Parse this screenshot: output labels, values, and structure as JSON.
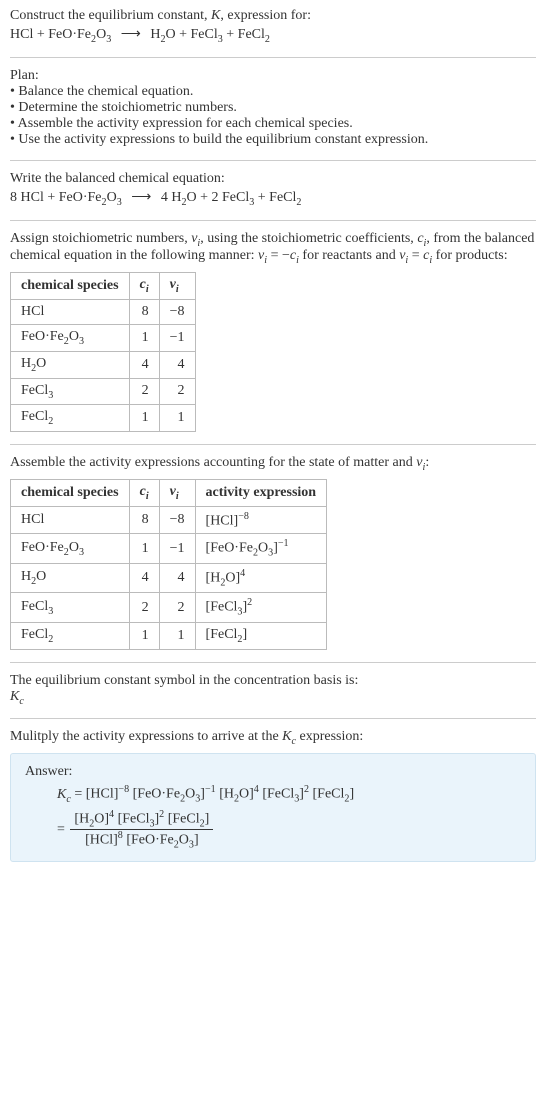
{
  "header": {
    "title_html": "Construct the equilibrium constant, <span class='italic'>K</span>, expression for:",
    "equation_html": "HCl + FeO·Fe<span class='sub'>2</span>O<span class='sub'>3</span> <span class='arrow'>⟶</span> H<span class='sub'>2</span>O + FeCl<span class='sub'>3</span> + FeCl<span class='sub'>2</span>"
  },
  "plan": {
    "heading": "Plan:",
    "items": [
      "Balance the chemical equation.",
      "Determine the stoichiometric numbers.",
      "Assemble the activity expression for each chemical species.",
      "Use the activity expressions to build the equilibrium constant expression."
    ]
  },
  "balanced": {
    "heading": "Write the balanced chemical equation:",
    "equation_html": "8 HCl + FeO·Fe<span class='sub'>2</span>O<span class='sub'>3</span> <span class='arrow'>⟶</span> 4 H<span class='sub'>2</span>O + 2 FeCl<span class='sub'>3</span> + FeCl<span class='sub'>2</span>"
  },
  "stoich": {
    "intro_html": "Assign stoichiometric numbers, <span class='italic'>ν<span class='sub'>i</span></span>, using the stoichiometric coefficients, <span class='italic'>c<span class='sub'>i</span></span>, from the balanced chemical equation in the following manner: <span class='italic'>ν<span class='sub'>i</span></span> = −<span class='italic'>c<span class='sub'>i</span></span> for reactants and <span class='italic'>ν<span class='sub'>i</span></span> = <span class='italic'>c<span class='sub'>i</span></span> for products:",
    "headers": {
      "species": "chemical species",
      "ci_html": "<span class='italic'>c<span class='sub'>i</span></span>",
      "vi_html": "<span class='italic'>ν<span class='sub'>i</span></span>"
    },
    "rows": [
      {
        "species_html": "HCl",
        "ci": "8",
        "vi": "−8"
      },
      {
        "species_html": "FeO·Fe<span class='sub'>2</span>O<span class='sub'>3</span>",
        "ci": "1",
        "vi": "−1"
      },
      {
        "species_html": "H<span class='sub'>2</span>O",
        "ci": "4",
        "vi": "4"
      },
      {
        "species_html": "FeCl<span class='sub'>3</span>",
        "ci": "2",
        "vi": "2"
      },
      {
        "species_html": "FeCl<span class='sub'>2</span>",
        "ci": "1",
        "vi": "1"
      }
    ]
  },
  "activity": {
    "intro_html": "Assemble the activity expressions accounting for the state of matter and <span class='italic'>ν<span class='sub'>i</span></span>:",
    "headers": {
      "species": "chemical species",
      "ci_html": "<span class='italic'>c<span class='sub'>i</span></span>",
      "vi_html": "<span class='italic'>ν<span class='sub'>i</span></span>",
      "activity": "activity expression"
    },
    "rows": [
      {
        "species_html": "HCl",
        "ci": "8",
        "vi": "−8",
        "act_html": "[HCl]<span class='sup'>−8</span>"
      },
      {
        "species_html": "FeO·Fe<span class='sub'>2</span>O<span class='sub'>3</span>",
        "ci": "1",
        "vi": "−1",
        "act_html": "[FeO·Fe<span class='sub'>2</span>O<span class='sub'>3</span>]<span class='sup'>−1</span>"
      },
      {
        "species_html": "H<span class='sub'>2</span>O",
        "ci": "4",
        "vi": "4",
        "act_html": "[H<span class='sub'>2</span>O]<span class='sup'>4</span>"
      },
      {
        "species_html": "FeCl<span class='sub'>3</span>",
        "ci": "2",
        "vi": "2",
        "act_html": "[FeCl<span class='sub'>3</span>]<span class='sup'>2</span>"
      },
      {
        "species_html": "FeCl<span class='sub'>2</span>",
        "ci": "1",
        "vi": "1",
        "act_html": "[FeCl<span class='sub'>2</span>]"
      }
    ]
  },
  "basis": {
    "line1": "The equilibrium constant symbol in the concentration basis is:",
    "symbol_html": "<span class='italic'>K<span class='sub'>c</span></span>"
  },
  "multiply": {
    "intro_html": "Mulitply the activity expressions to arrive at the <span class='italic'>K<span class='sub'>c</span></span> expression:"
  },
  "answer": {
    "label": "Answer:",
    "line1_html": "<span class='italic'>K<span class='sub'>c</span></span> = [HCl]<span class='sup'>−8</span> [FeO·Fe<span class='sub'>2</span>O<span class='sub'>3</span>]<span class='sup'>−1</span> [H<span class='sub'>2</span>O]<span class='sup'>4</span> [FeCl<span class='sub'>3</span>]<span class='sup'>2</span> [FeCl<span class='sub'>2</span>]",
    "frac_num_html": "[H<span class='sub'>2</span>O]<span class='sup'>4</span> [FeCl<span class='sub'>3</span>]<span class='sup'>2</span> [FeCl<span class='sub'>2</span>]",
    "frac_den_html": "[HCl]<span class='sup'>8</span> [FeO·Fe<span class='sub'>2</span>O<span class='sub'>3</span>]"
  }
}
